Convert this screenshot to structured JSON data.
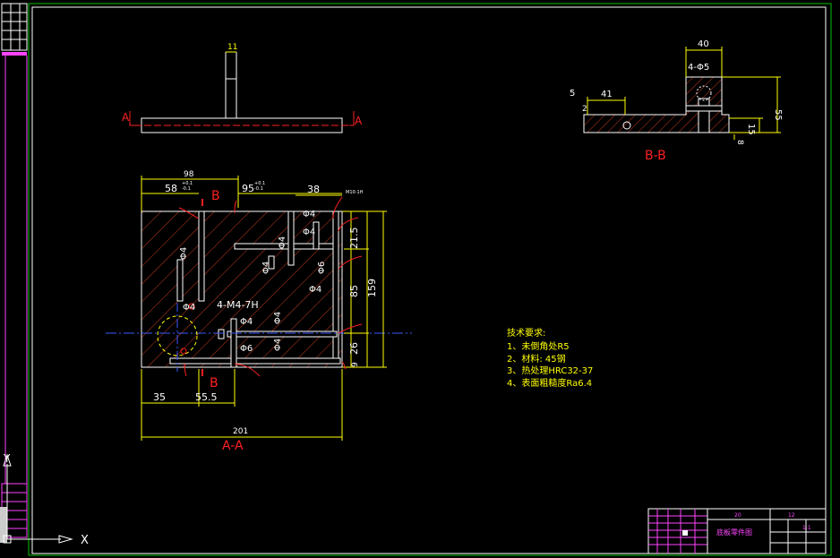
{
  "top_view": {
    "dim_width": "11",
    "section_marker": "A"
  },
  "section_aa": {
    "title": "A-A",
    "marker": "B",
    "dims": {
      "top_98": "98",
      "d58": "58",
      "d95": "95",
      "d38": "38",
      "d201": "201",
      "d35": "35",
      "d55_5": "55.5",
      "d21_5": "21.5",
      "d85": "85",
      "d159": "159",
      "d26": "26",
      "d9": "9",
      "tol_upper": "+0.1",
      "tol_lower": "-0.1"
    },
    "holes": {
      "phi4": "Φ4",
      "phi6": "Φ6",
      "thread": "4-M4-7H",
      "m10": "M10-1H"
    }
  },
  "section_bb": {
    "title": "B-B",
    "dims": {
      "d40": "40",
      "holes": "4-Φ5",
      "d5": "5",
      "d41": "41",
      "d2": "2",
      "d55": "55",
      "d15": "15",
      "d8": "8"
    }
  },
  "tech_notes": {
    "heading": "技术要求:",
    "items": [
      "1、未倒角处R5",
      "2、材料: 45钢",
      "3、热处理HRC32-37",
      "4、表面粗糙度Ra6.4"
    ]
  },
  "title_block": {
    "part_name": "底板零件图",
    "n1": "20",
    "n2": "12",
    "n3": "1:1"
  },
  "ucs": {
    "x_label": "X",
    "y_label": "Y"
  }
}
